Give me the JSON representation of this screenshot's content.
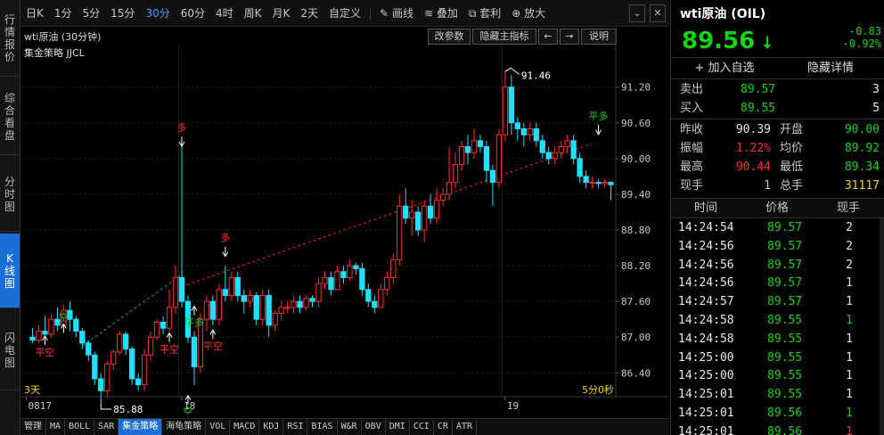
{
  "left_nav": [
    "行情报价",
    "综合看盘",
    "分时图",
    "K线图",
    "闪电图"
  ],
  "toolbar": {
    "periods": [
      "日K",
      "1分",
      "5分",
      "15分",
      "30分",
      "60分",
      "4时",
      "周K",
      "月K",
      "2天",
      "自定义"
    ],
    "active_period": "30分",
    "tools": [
      "画线",
      "叠加",
      "套利",
      "放大"
    ]
  },
  "chart_header": {
    "title": "wti原油 (30分钟)",
    "indicator": "集金策略 JJCL",
    "buttons": [
      "改参数",
      "隐藏主指标",
      "←",
      "→",
      "说明"
    ]
  },
  "chart_data": {
    "type": "candlestick",
    "y_ticks": [
      "91.20",
      "90.60",
      "90.00",
      "89.40",
      "88.80",
      "88.20",
      "87.60",
      "87.00",
      "86.40"
    ],
    "x_labels": [
      "0817",
      "18",
      "19"
    ],
    "ylim": [
      86.0,
      91.6
    ],
    "candles": [
      [
        87.0,
        86.95,
        87.15,
        86.9
      ],
      [
        86.95,
        87.1,
        87.2,
        86.9
      ],
      [
        87.1,
        87.05,
        87.35,
        86.95
      ],
      [
        87.05,
        87.3,
        87.4,
        87.0
      ],
      [
        87.3,
        87.2,
        87.5,
        87.1
      ],
      [
        87.2,
        87.45,
        87.55,
        87.15
      ],
      [
        87.45,
        87.3,
        87.6,
        87.1
      ],
      [
        87.3,
        87.1,
        87.35,
        87.0
      ],
      [
        87.1,
        86.9,
        87.15,
        86.8
      ],
      [
        86.9,
        86.7,
        86.95,
        86.6
      ],
      [
        86.7,
        86.3,
        86.75,
        86.2
      ],
      [
        86.3,
        86.1,
        86.4,
        85.88
      ],
      [
        86.1,
        86.55,
        86.6,
        86.0
      ],
      [
        86.55,
        86.75,
        86.8,
        86.45
      ],
      [
        86.75,
        87.05,
        87.1,
        86.7
      ],
      [
        87.05,
        86.8,
        87.1,
        86.7
      ],
      [
        86.8,
        86.3,
        86.85,
        86.2
      ],
      [
        86.3,
        86.2,
        86.4,
        86.1
      ],
      [
        86.2,
        86.7,
        86.8,
        86.1
      ],
      [
        86.7,
        87.0,
        87.1,
        86.6
      ],
      [
        87.0,
        87.25,
        87.3,
        86.95
      ],
      [
        87.25,
        87.15,
        87.35,
        87.05
      ],
      [
        87.15,
        87.5,
        87.8,
        87.1
      ],
      [
        87.5,
        88.0,
        88.2,
        87.4
      ],
      [
        88.0,
        87.6,
        90.2,
        87.5
      ],
      [
        87.6,
        87.0,
        87.7,
        86.9
      ],
      [
        87.0,
        86.5,
        87.1,
        86.2
      ],
      [
        86.5,
        87.3,
        87.4,
        86.4
      ],
      [
        87.3,
        87.6,
        87.7,
        87.1
      ],
      [
        87.6,
        87.3,
        87.7,
        87.2
      ],
      [
        87.3,
        87.8,
        87.9,
        87.2
      ],
      [
        87.8,
        87.7,
        88.2,
        87.6
      ],
      [
        87.7,
        88.0,
        88.1,
        87.6
      ],
      [
        88.0,
        87.7,
        88.1,
        87.6
      ],
      [
        87.7,
        87.6,
        87.8,
        87.4
      ],
      [
        87.6,
        87.7,
        87.8,
        87.5
      ],
      [
        87.7,
        87.3,
        87.75,
        87.2
      ],
      [
        87.3,
        87.7,
        87.8,
        87.2
      ],
      [
        87.7,
        87.2,
        87.8,
        87.0
      ],
      [
        87.2,
        87.4,
        87.45,
        87.1
      ],
      [
        87.4,
        87.5,
        87.6,
        87.3
      ],
      [
        87.5,
        87.5,
        87.6,
        87.4
      ],
      [
        87.5,
        87.6,
        87.7,
        87.4
      ],
      [
        87.6,
        87.5,
        87.7,
        87.4
      ],
      [
        87.5,
        87.65,
        87.7,
        87.45
      ],
      [
        87.65,
        87.6,
        87.7,
        87.5
      ],
      [
        87.6,
        87.9,
        88.0,
        87.5
      ],
      [
        87.9,
        88.0,
        88.1,
        87.8
      ],
      [
        88.0,
        87.8,
        88.1,
        87.7
      ],
      [
        87.8,
        88.1,
        88.2,
        87.8
      ],
      [
        88.1,
        88.0,
        88.2,
        87.9
      ],
      [
        88.0,
        88.2,
        88.3,
        87.95
      ],
      [
        88.2,
        88.15,
        88.25,
        88.05
      ],
      [
        88.15,
        87.8,
        88.25,
        87.7
      ],
      [
        87.8,
        87.6,
        87.9,
        87.5
      ],
      [
        87.6,
        87.5,
        87.7,
        87.4
      ],
      [
        87.5,
        87.8,
        87.9,
        87.5
      ],
      [
        87.8,
        88.0,
        88.1,
        87.7
      ],
      [
        88.0,
        88.3,
        88.4,
        87.9
      ],
      [
        88.3,
        89.2,
        89.4,
        88.2
      ],
      [
        89.2,
        89.0,
        89.5,
        88.9
      ],
      [
        89.0,
        89.1,
        89.3,
        88.7
      ],
      [
        89.1,
        88.8,
        89.2,
        88.7
      ],
      [
        88.8,
        89.2,
        89.3,
        88.6
      ],
      [
        89.2,
        89.0,
        89.4,
        88.9
      ],
      [
        89.0,
        89.3,
        89.5,
        88.9
      ],
      [
        89.3,
        89.4,
        89.5,
        89.2
      ],
      [
        89.4,
        89.6,
        90.2,
        89.3
      ],
      [
        89.6,
        89.9,
        90.1,
        89.5
      ],
      [
        89.9,
        90.2,
        90.3,
        89.8
      ],
      [
        90.2,
        90.1,
        90.4,
        89.9
      ],
      [
        90.1,
        90.3,
        90.5,
        90.0
      ],
      [
        90.3,
        90.2,
        90.4,
        90.1
      ],
      [
        90.2,
        89.8,
        90.3,
        89.6
      ],
      [
        89.8,
        89.6,
        89.9,
        89.2
      ],
      [
        89.6,
        90.4,
        90.5,
        89.5
      ],
      [
        90.4,
        91.2,
        91.46,
        90.3
      ],
      [
        91.2,
        90.6,
        91.4,
        90.4
      ],
      [
        90.6,
        90.5,
        90.7,
        90.3
      ],
      [
        90.5,
        90.4,
        90.6,
        90.2
      ],
      [
        90.4,
        90.5,
        90.6,
        90.3
      ],
      [
        90.5,
        90.3,
        90.6,
        90.2
      ],
      [
        90.3,
        90.1,
        90.4,
        90.0
      ],
      [
        90.1,
        90.0,
        90.2,
        89.9
      ],
      [
        90.0,
        90.1,
        90.2,
        89.9
      ],
      [
        90.1,
        90.2,
        90.3,
        90.0
      ],
      [
        90.2,
        90.3,
        90.4,
        90.1
      ],
      [
        90.3,
        90.0,
        90.4,
        89.9
      ],
      [
        90.0,
        89.7,
        90.1,
        89.6
      ],
      [
        89.7,
        89.6,
        89.8,
        89.5
      ],
      [
        89.6,
        89.6,
        89.7,
        89.5
      ],
      [
        89.6,
        89.58,
        89.65,
        89.5
      ],
      [
        89.58,
        89.6,
        89.65,
        89.52
      ],
      [
        89.6,
        89.56,
        89.62,
        89.3
      ]
    ],
    "annotations": {
      "high": "91.46",
      "low": "85.88",
      "days": "3天",
      "countdown": "5分0秒"
    },
    "signals": [
      "平空",
      "空",
      "多",
      "平多",
      "平空",
      "多",
      "平空",
      "空",
      "平多"
    ]
  },
  "quote": {
    "name": "wti原油 (OIL)",
    "price": "89.56",
    "change": "-0.83",
    "change_pct": "-0.92%",
    "add_watch": "+ 加入自选",
    "hide_detail": "隐藏详情",
    "ask_label": "卖出",
    "ask_price": "89.57",
    "ask_vol": "3",
    "bid_label": "买入",
    "bid_price": "89.55",
    "bid_vol": "5",
    "stats": [
      [
        "昨收",
        "90.39",
        "开盘",
        "90.00"
      ],
      [
        "振幅",
        "1.22%",
        "均价",
        "89.92"
      ],
      [
        "最高",
        "90.44",
        "最低",
        "89.34"
      ],
      [
        "现手",
        "1",
        "总手",
        "31117"
      ]
    ]
  },
  "ticks": {
    "headers": [
      "时间",
      "价格",
      "现手"
    ],
    "rows": [
      [
        "14:24:54",
        "89.57",
        "2"
      ],
      [
        "14:24:56",
        "89.57",
        "2"
      ],
      [
        "14:24:56",
        "89.57",
        "2"
      ],
      [
        "14:24:56",
        "89.57",
        "1"
      ],
      [
        "14:24:57",
        "89.57",
        "1"
      ],
      [
        "14:24:58",
        "89.55",
        "1"
      ],
      [
        "14:24:58",
        "89.55",
        "1"
      ],
      [
        "14:25:00",
        "89.55",
        "1"
      ],
      [
        "14:25:00",
        "89.55",
        "1"
      ],
      [
        "14:25:01",
        "89.55",
        "1"
      ],
      [
        "14:25:01",
        "89.56",
        "1"
      ],
      [
        "14:25:01",
        "89.56",
        "1"
      ]
    ]
  },
  "bottom_tabs": [
    "管理",
    "MA",
    "BOLL",
    "SAR",
    "集金策略",
    "海龟策略",
    "VOL",
    "MACD",
    "KDJ",
    "RSI",
    "BIAS",
    "W&R",
    "OBV",
    "DMI",
    "CCI",
    "CR",
    "ATR"
  ],
  "active_bottom_tab": "集金策略",
  "colors": {
    "up": "#ff2d2d",
    "down": "#20e0ff",
    "accent": "#1d6fd8",
    "price_green": "#13d313"
  }
}
